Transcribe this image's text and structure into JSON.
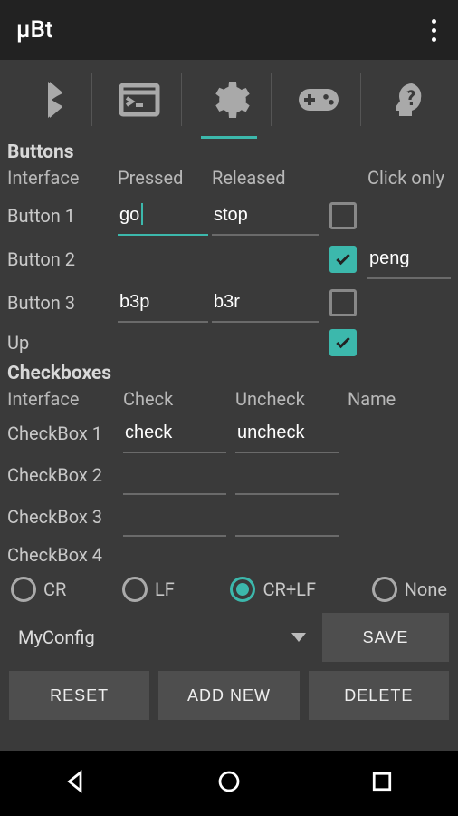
{
  "app": {
    "title": "µBt"
  },
  "tabs": {
    "items": [
      {
        "icon": "bluetooth-icon"
      },
      {
        "icon": "terminal-icon"
      },
      {
        "icon": "gear-icon",
        "active": true
      },
      {
        "icon": "gamepad-icon"
      },
      {
        "icon": "help-head-icon"
      }
    ]
  },
  "buttons_section": {
    "title": "Buttons",
    "headers": {
      "interface": "Interface",
      "pressed": "Pressed",
      "released": "Released",
      "click_only": "Click only"
    },
    "rows": {
      "b1": {
        "label": "Button 1",
        "pressed": "go",
        "released": "stop",
        "click_only": false,
        "name": ""
      },
      "b2": {
        "label": "Button 2",
        "pressed": "",
        "released": "",
        "click_only": true,
        "name": "peng"
      },
      "b3": {
        "label": "Button 3",
        "pressed": "b3p",
        "released": "b3r",
        "click_only": false,
        "name": ""
      },
      "up": {
        "label": "Up",
        "click_only": true
      }
    }
  },
  "checkboxes_section": {
    "title": "Checkboxes",
    "headers": {
      "interface": "Interface",
      "check": "Check",
      "uncheck": "Uncheck",
      "name": "Name"
    },
    "rows": {
      "c1": {
        "label": "CheckBox 1",
        "check": "check",
        "uncheck": "uncheck"
      },
      "c2": {
        "label": "CheckBox 2",
        "check": "",
        "uncheck": ""
      },
      "c3": {
        "label": "CheckBox 3",
        "check": "",
        "uncheck": ""
      },
      "c4": {
        "label": "CheckBox 4"
      }
    }
  },
  "line_ending": {
    "options": {
      "cr": "CR",
      "lf": "LF",
      "crlf": "CR+LF",
      "none": "None"
    },
    "selected": "crlf"
  },
  "config": {
    "spinner_value": "MyConfig",
    "save": "SAVE",
    "reset": "RESET",
    "add_new": "ADD NEW",
    "delete": "DELETE"
  },
  "colors": {
    "accent": "#3cb8ac",
    "bg": "#3a3a3a",
    "btn": "#4e4e4e"
  }
}
